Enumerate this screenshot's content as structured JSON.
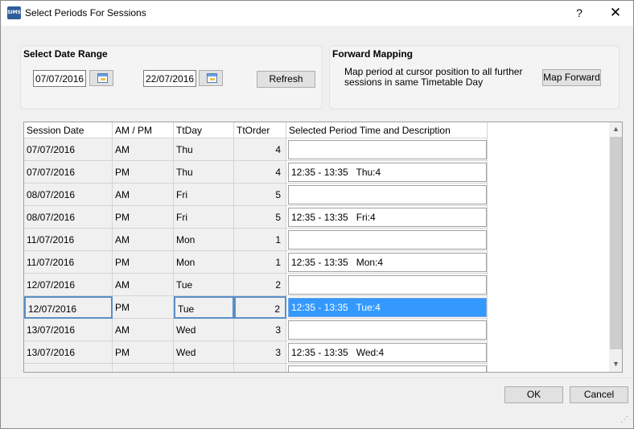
{
  "window": {
    "app_icon_text": "SIMS",
    "title": "Select Periods For Sessions",
    "help_label": "?",
    "close_label": "✕"
  },
  "date_range": {
    "title": "Select Date Range",
    "start_date": "07/07/2016",
    "end_date": "22/07/2016",
    "refresh_label": "Refresh"
  },
  "forward_mapping": {
    "title": "Forward Mapping",
    "description": "Map period at cursor position to all further sessions in same Timetable Day",
    "button_label": "Map Forward"
  },
  "grid": {
    "columns": [
      "Session Date",
      "AM / PM",
      "TtDay",
      "TtOrder",
      "Selected Period Time and Description"
    ],
    "selected_row_index": 7,
    "rows": [
      {
        "date": "07/07/2016",
        "ampm": "AM",
        "day": "Thu",
        "order": "4",
        "period": ""
      },
      {
        "date": "07/07/2016",
        "ampm": "PM",
        "day": "Thu",
        "order": "4",
        "period": "12:35 - 13:35   Thu:4"
      },
      {
        "date": "08/07/2016",
        "ampm": "AM",
        "day": "Fri",
        "order": "5",
        "period": ""
      },
      {
        "date": "08/07/2016",
        "ampm": "PM",
        "day": "Fri",
        "order": "5",
        "period": "12:35 - 13:35   Fri:4"
      },
      {
        "date": "11/07/2016",
        "ampm": "AM",
        "day": "Mon",
        "order": "1",
        "period": ""
      },
      {
        "date": "11/07/2016",
        "ampm": "PM",
        "day": "Mon",
        "order": "1",
        "period": "12:35 - 13:35   Mon:4"
      },
      {
        "date": "12/07/2016",
        "ampm": "AM",
        "day": "Tue",
        "order": "2",
        "period": ""
      },
      {
        "date": "12/07/2016",
        "ampm": "PM",
        "day": "Tue",
        "order": "2",
        "period": "12:35 - 13:35   Tue:4"
      },
      {
        "date": "13/07/2016",
        "ampm": "AM",
        "day": "Wed",
        "order": "3",
        "period": ""
      },
      {
        "date": "13/07/2016",
        "ampm": "PM",
        "day": "Wed",
        "order": "3",
        "period": "12:35 - 13:35   Wed:4"
      },
      {
        "date": "",
        "ampm": "",
        "day": "",
        "order": "",
        "period": ""
      }
    ]
  },
  "footer": {
    "ok_label": "OK",
    "cancel_label": "Cancel"
  },
  "colors": {
    "selection": "#3399ff",
    "selection_border": "#5b8fc7",
    "dialog_bg": "#f0f0f0",
    "app_icon": "#2f5d9a"
  },
  "icons": {
    "app": "sims-app-icon",
    "calendar": "calendar-icon",
    "scroll_up": "chevron-up-icon",
    "scroll_down": "chevron-down-icon",
    "grip": "resize-grip-icon"
  }
}
